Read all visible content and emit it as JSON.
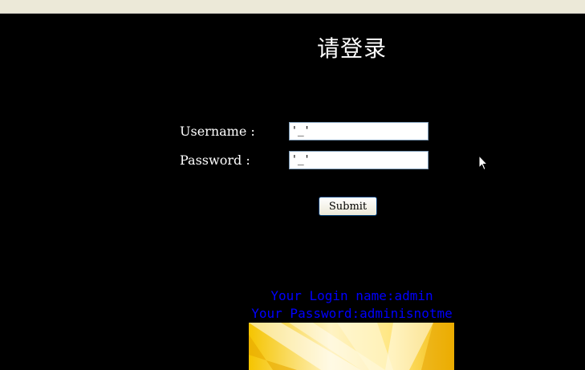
{
  "page": {
    "title": "请登录"
  },
  "login": {
    "username_label": "Username :",
    "username_value": "'_'",
    "password_label": "Password :",
    "password_value": "'_'",
    "submit_label": "Submit"
  },
  "result": {
    "login_name_text": "Your Login name:admin",
    "password_text": "Your Password:adminisnotme"
  },
  "colors": {
    "background": "#000000",
    "text": "#ffffff",
    "info_text": "#0000ff",
    "browser_chrome": "#ece9d8"
  },
  "icons": {
    "cursor": "mouse-pointer-icon"
  }
}
